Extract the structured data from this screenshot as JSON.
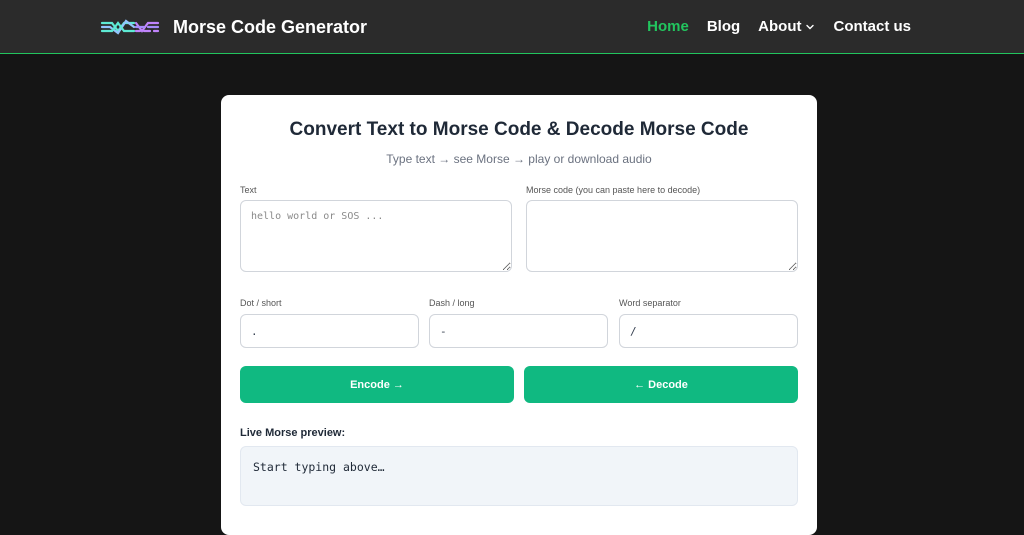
{
  "nav": {
    "brand": "Morse Code Generator",
    "links": [
      {
        "label": "Home"
      },
      {
        "label": "Blog"
      },
      {
        "label": "About"
      },
      {
        "label": "Contact us"
      }
    ]
  },
  "colors": {
    "accent": "#22c55e",
    "button": "#10b981",
    "nav_bg": "#2b2b2b",
    "page_bg": "#151515"
  },
  "main": {
    "title": "Convert Text to Morse Code & Decode Morse Code",
    "subtitle": "Type text → see Morse → play or download audio",
    "text_label": "Text",
    "text_placeholder": "hello world or SOS ...",
    "text_value": "",
    "morse_label": "Morse code (you can paste here to decode)",
    "morse_value": "",
    "dot_label": "Dot / short",
    "dot_value": ".",
    "dash_label": "Dash / long",
    "dash_value": "-",
    "sep_label": "Word separator",
    "sep_value": "/",
    "encode_label": "Encode →",
    "decode_label": "← Decode",
    "preview_label": "Live Morse preview:",
    "preview_text": "Start typing above…"
  }
}
